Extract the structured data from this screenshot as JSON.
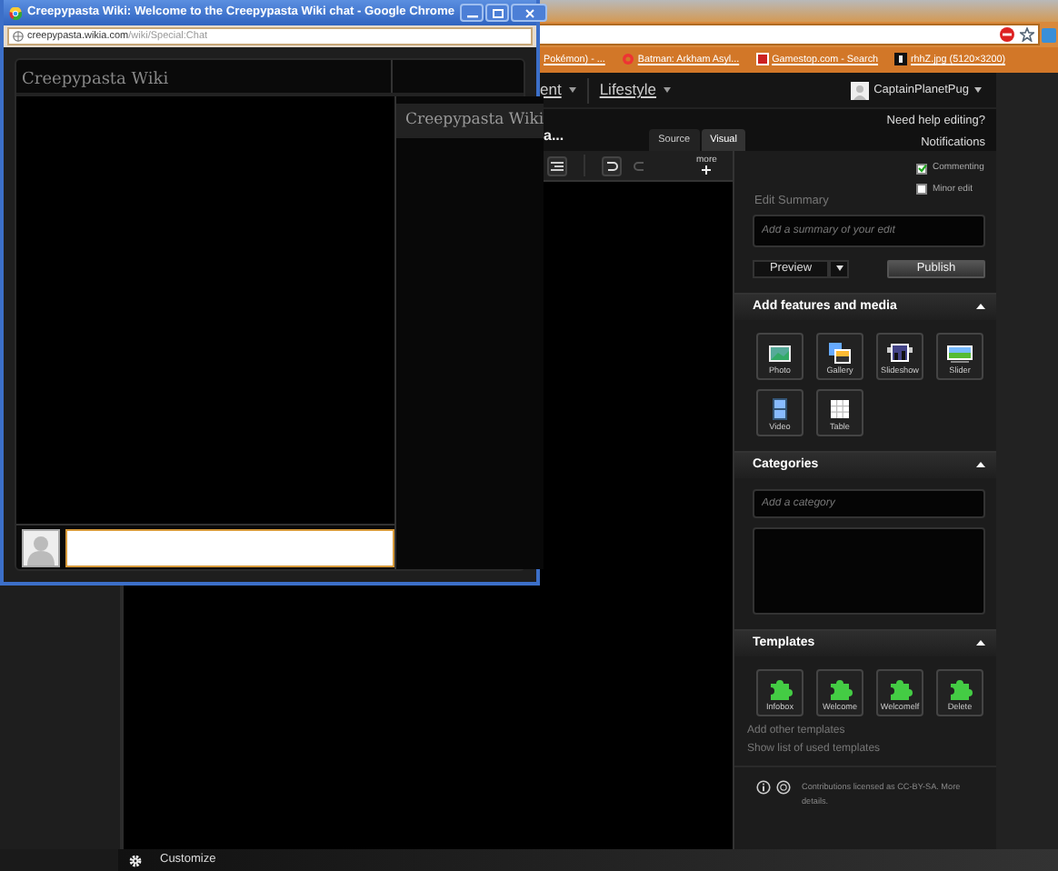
{
  "browser": {
    "bookmarks": [
      {
        "label": "Pokémon) - ...",
        "kind": "none"
      },
      {
        "label": "Batman: Arkham Asyl...",
        "kind": "batman"
      },
      {
        "label": "Gamestop.com - Search",
        "kind": "gamestop"
      },
      {
        "label": "rhhZ.jpg (5120×3200)",
        "kind": "image"
      }
    ]
  },
  "wiki": {
    "nav": [
      "ent",
      "Lifestyle"
    ],
    "user": "CaptainPlanetPug",
    "page_title": "a...",
    "help_links": [
      "Need help editing?",
      "Notifications"
    ],
    "mode_tabs": [
      {
        "label": "Source",
        "selected": false
      },
      {
        "label": "Visual",
        "selected": true
      }
    ],
    "toolbar_more": "more",
    "checkboxes": [
      {
        "label": "Commenting",
        "checked": true
      },
      {
        "label": "Minor edit",
        "checked": false
      }
    ],
    "edit_summary": {
      "label": "Edit Summary",
      "placeholder": "Add a summary of your edit"
    },
    "preview": "Preview",
    "publish": "Publish",
    "features": {
      "title": "Add features and media",
      "items": [
        {
          "label": "Photo",
          "kind": "photo"
        },
        {
          "label": "Gallery",
          "kind": "gallery"
        },
        {
          "label": "Slideshow",
          "kind": "slideshow"
        },
        {
          "label": "Slider",
          "kind": "slider"
        },
        {
          "label": "Video",
          "kind": "video"
        },
        {
          "label": "Table",
          "kind": "table"
        }
      ]
    },
    "categories": {
      "title": "Categories",
      "placeholder": "Add a category"
    },
    "templates": {
      "title": "Templates",
      "items": [
        "Infobox",
        "Welcome",
        "Welcomelf",
        "Delete"
      ],
      "links": [
        "Add other templates",
        "Show list of used templates"
      ]
    },
    "license": "Contributions licensed as CC-BY-SA. More details.",
    "customize": "Customize"
  },
  "chat_window": {
    "title": "Creepypasta Wiki: Welcome to the Creepypasta Wiki chat - Google Chrome",
    "url_host": "creepypasta.wikia.com",
    "url_path": "/wiki/Special:Chat",
    "header": "Creepypasta Wiki",
    "user_list_header": "Creepypasta Wiki"
  }
}
